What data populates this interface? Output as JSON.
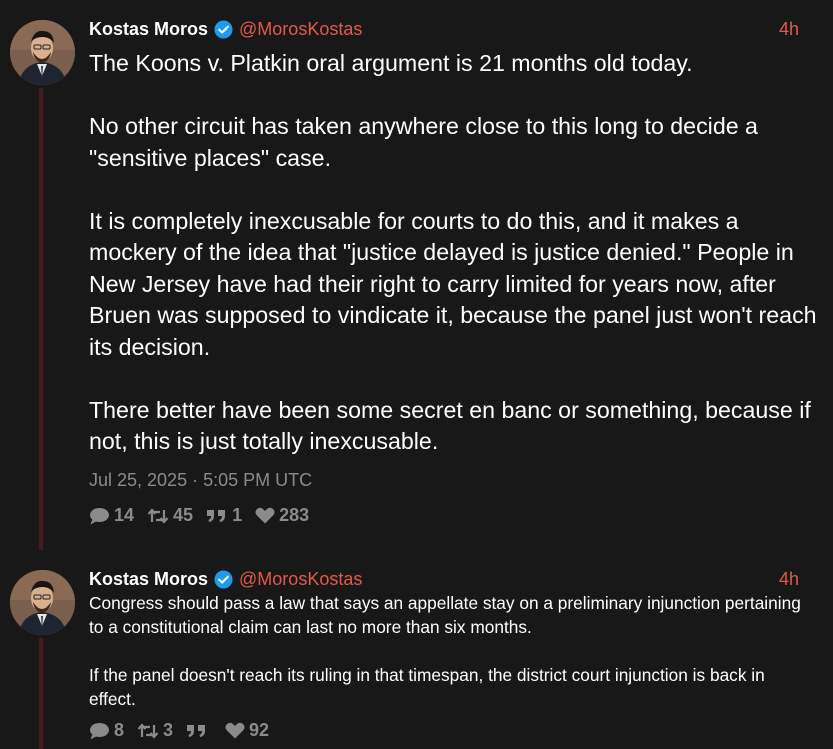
{
  "tweets": [
    {
      "author_name": "Kostas Moros",
      "handle": "@MorosKostas",
      "time": "4h",
      "paragraphs": [
        "The Koons v. Platkin oral argument is 21 months old today.",
        "No other circuit has taken anywhere close to this long to decide a \"sensitive places\" case.",
        "It is completely inexcusable for courts to do this, and it makes a mockery of the idea that \"justice delayed is justice denied.\" People in New Jersey have had their right to carry limited for years now, after Bruen was supposed to vindicate it, because the panel just won't reach its decision.",
        "There better have been some secret en banc or something, because if not, this is just totally inexcusable."
      ],
      "date": "Jul 25, 2025 · 5:05 PM UTC",
      "replies": "14",
      "retweets": "45",
      "quotes": "1",
      "likes": "283"
    },
    {
      "author_name": "Kostas Moros",
      "handle": "@MorosKostas",
      "time": "4h",
      "paragraphs": [
        "Congress should pass a law that says an appellate stay on a preliminary injunction pertaining to a constitutional claim can last no more than six months.",
        "If the panel doesn't reach its ruling in that timespan, the district court injunction is back in effect."
      ],
      "replies": "8",
      "retweets": "3",
      "quotes": "",
      "likes": "92"
    }
  ],
  "icons": {
    "reply": "comment-icon",
    "retweet": "retweet-icon",
    "quote": "quote-icon",
    "like": "heart-icon",
    "verified": "verified-badge-icon"
  },
  "colors": {
    "background": "#181818",
    "accent": "#e25a4a",
    "muted": "#8b8b8b",
    "thread_line": "#4a1a1d",
    "verified": "#1d9bf0"
  }
}
